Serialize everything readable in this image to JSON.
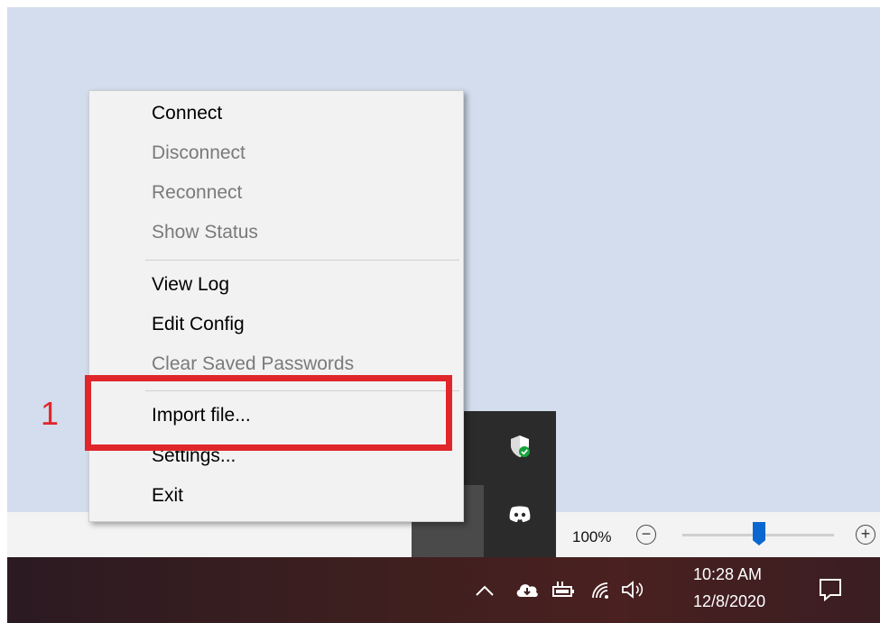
{
  "context_menu": {
    "items": [
      {
        "label": "Connect",
        "enabled": true
      },
      {
        "label": "Disconnect",
        "enabled": false
      },
      {
        "label": "Reconnect",
        "enabled": false
      },
      {
        "label": "Show Status",
        "enabled": false
      },
      {
        "label": "View Log",
        "enabled": true
      },
      {
        "label": "Edit Config",
        "enabled": true
      },
      {
        "label": "Clear Saved Passwords",
        "enabled": false
      },
      {
        "label": "Import file...",
        "enabled": true
      },
      {
        "label": "Settings...",
        "enabled": true
      },
      {
        "label": "Exit",
        "enabled": true
      }
    ]
  },
  "annotation": {
    "number": "1",
    "color": "#e0262b"
  },
  "zoom": {
    "level": "100%",
    "minus": "−",
    "plus": "+"
  },
  "tray_flyout": {
    "icons": [
      "windows-security-icon",
      "monitor-network-icon",
      "discord-icon"
    ]
  },
  "taskbar": {
    "time": "10:28 AM",
    "date": "12/8/2020",
    "icons": [
      "chevron-up-icon",
      "onedrive-cloud-icon",
      "battery-plug-icon",
      "wifi-icon",
      "speaker-icon",
      "notification-icon"
    ]
  },
  "colors": {
    "desktop": "#d3dded",
    "menu_bg": "#f2f2f2",
    "disabled_text": "#7a7a7a",
    "accent": "#0b67d0"
  }
}
